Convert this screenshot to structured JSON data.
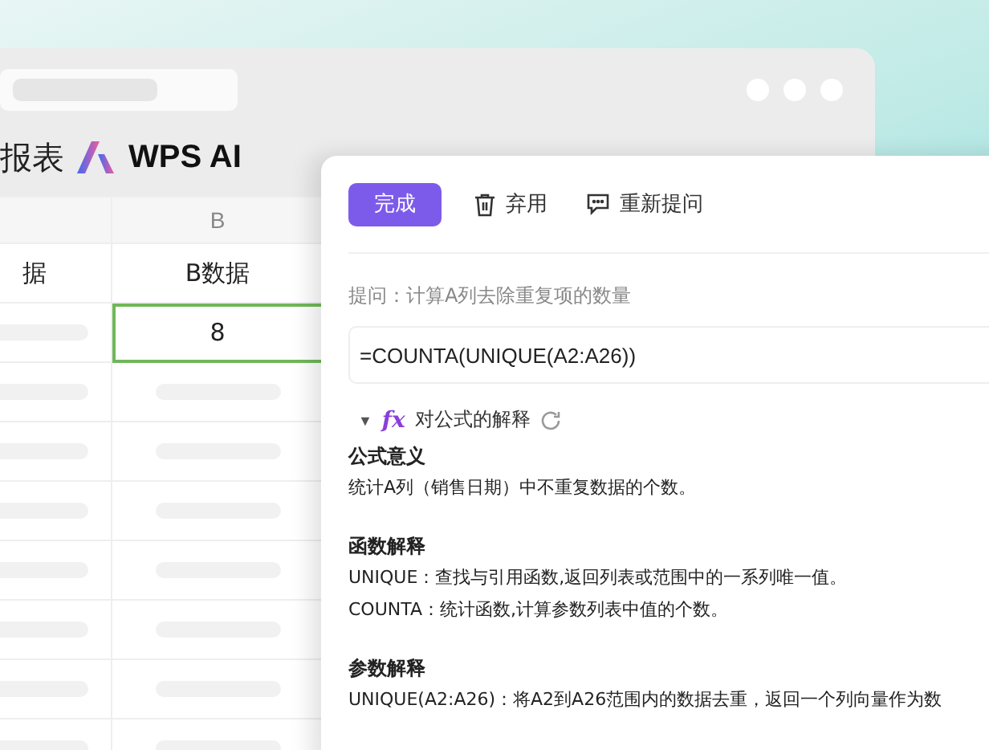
{
  "sheet": {
    "title": "报表",
    "brand": "WPS AI",
    "table": {
      "column_b": "B",
      "header_cells": [
        "据",
        "B数据"
      ],
      "first_row": {
        "value": "8",
        "selected": true
      }
    }
  },
  "panel": {
    "buttons": [
      {
        "label": "完成",
        "kind": "primary"
      },
      {
        "label": "弃用",
        "kind": "discard"
      },
      {
        "label": "重新提问",
        "kind": "retry"
      }
    ],
    "question": "提问：计算A列去除重复项的数量",
    "formula": "=COUNTA(UNIQUE(A2:A26))",
    "explanation": {
      "toggle": "▼",
      "fx": "fx",
      "title": "对公式的解释",
      "expanded": true,
      "sections": [
        {
          "heading": "公式意义",
          "lines": [
            "统计A列（销售日期）中不重复数据的个数。"
          ]
        },
        {
          "heading": "函数解释",
          "lines": [
            "UNIQUE：查找与引用函数,返回列表或范围中的一系列唯一值。",
            "COUNTA：统计函数,计算参数列表中值的个数。"
          ]
        },
        {
          "heading": "参数解释",
          "lines": [
            "UNIQUE(A2:A26)：将A2到A26范围内的数据去重，返回一个列向量作为数"
          ]
        }
      ]
    }
  }
}
